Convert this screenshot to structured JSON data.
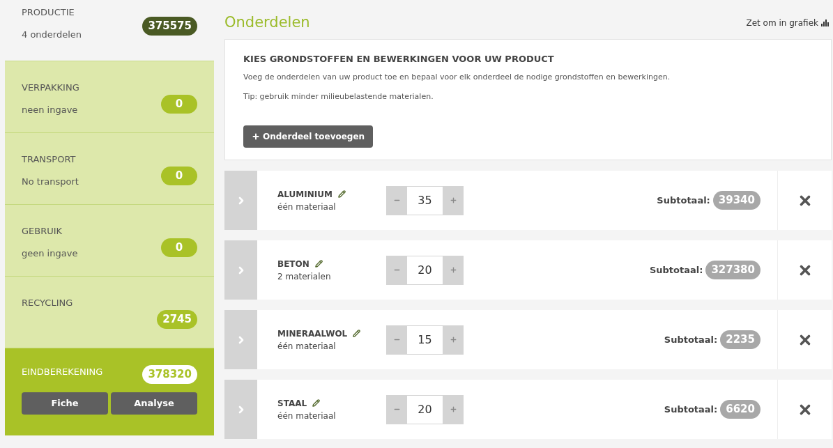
{
  "sidebar": {
    "items": [
      {
        "kind": "production",
        "title": "PRODUCTIE",
        "subtitle": "4 onderdelen",
        "value": "375575"
      },
      {
        "kind": "phase",
        "title": "VERPAKKING",
        "subtitle": "neen ingave",
        "value": "0"
      },
      {
        "kind": "phase",
        "title": "TRANSPORT",
        "subtitle": "No transport",
        "value": "0"
      },
      {
        "kind": "phase",
        "title": "GEBRUIK",
        "subtitle": "geen ingave",
        "value": "0"
      },
      {
        "kind": "phase",
        "title": "RECYCLING",
        "value": "2745"
      },
      {
        "kind": "total",
        "title": "EINDBEREKENING",
        "value": "378320",
        "buttons": [
          "Fiche",
          "Analyse"
        ]
      }
    ]
  },
  "main": {
    "title": "Onderdelen",
    "chart_toggle": "Zet om in grafiek",
    "intro": {
      "heading": "KIES GRONDSTOFFEN EN BEWERKINGEN VOOR UW PRODUCT",
      "text": "Voeg de onderdelen van uw product toe en bepaal voor elk onderdeel de nodige grondstoffen en bewerkingen.",
      "tip": "Tip: gebruik minder milieubelastende materialen.",
      "button": "Onderdeel toevoegen"
    },
    "parts": [
      {
        "name": "ALUMINIUM",
        "materials": "één materiaal",
        "quantity": "35",
        "subtotal_label": "Subtotaal:",
        "subtotal": "39340"
      },
      {
        "name": "BETON",
        "materials": "2 materialen",
        "quantity": "20",
        "subtotal_label": "Subtotaal:",
        "subtotal": "327380"
      },
      {
        "name": "MINERAALWOL",
        "materials": "één materiaal",
        "quantity": "15",
        "subtotal_label": "Subtotaal:",
        "subtotal": "2235"
      },
      {
        "name": "STAAL",
        "materials": "één materiaal",
        "quantity": "20",
        "subtotal_label": "Subtotaal:",
        "subtotal": "6620"
      }
    ]
  }
}
